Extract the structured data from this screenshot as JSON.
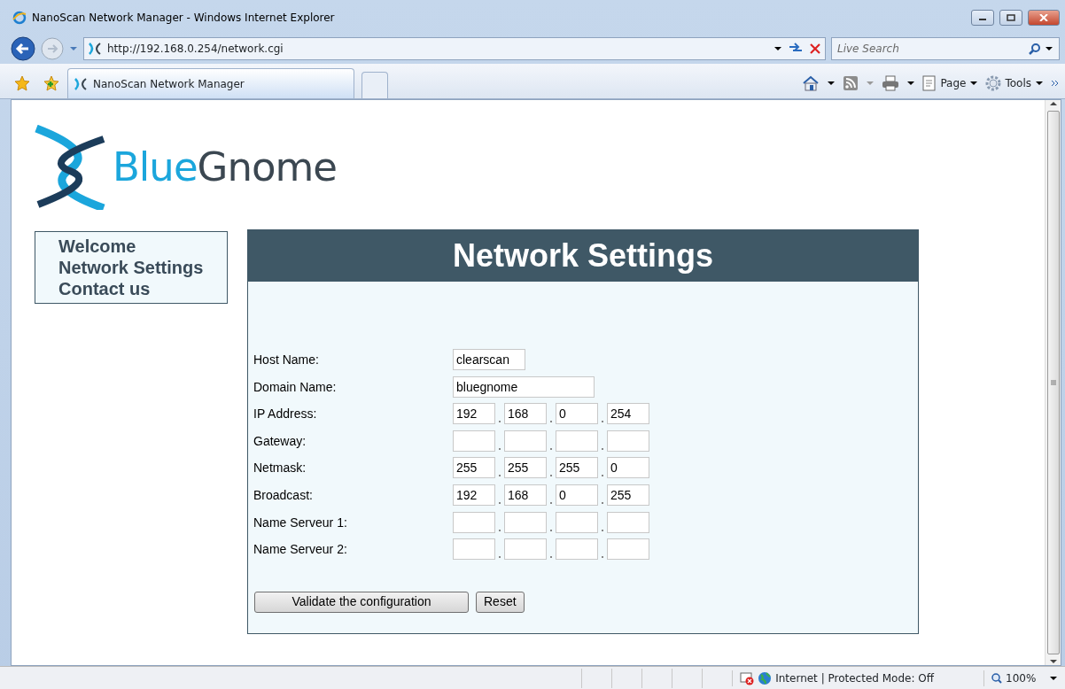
{
  "window": {
    "title": "NanoScan Network Manager - Windows Internet Explorer"
  },
  "address_bar": {
    "url": "http://192.168.0.254/network.cgi"
  },
  "search": {
    "placeholder": "Live Search"
  },
  "tabs": [
    {
      "label": "NanoScan Network Manager",
      "selected": true
    }
  ],
  "command_bar": [
    {
      "label": "Page"
    },
    {
      "label": "Tools"
    }
  ],
  "logo": {
    "part_1": "Blue",
    "part_2": "Gnome"
  },
  "nav": [
    {
      "label": "Welcome"
    },
    {
      "label": "Network Settings"
    },
    {
      "label": "Contact us"
    }
  ],
  "panel": {
    "title": "Network Settings"
  },
  "fields": [
    {
      "label": "Host Name:",
      "kind": "short_text",
      "value": "clearscan"
    },
    {
      "label": "Domain Name:",
      "kind": "long_text",
      "value": "bluegnome"
    },
    {
      "label": "IP Address:",
      "kind": "ip",
      "octets": [
        "192",
        "168",
        "0",
        "254"
      ]
    },
    {
      "label": "Gateway:",
      "kind": "ip"
    },
    {
      "label": "Netmask:",
      "kind": "ip",
      "octets": [
        "255",
        "255",
        "255",
        "0"
      ]
    },
    {
      "label": "Broadcast:",
      "kind": "ip",
      "octets": [
        "192",
        "168",
        "0",
        "255"
      ]
    },
    {
      "label": "Name Serveur 1:",
      "kind": "ip"
    },
    {
      "label": "Name Serveur 2:",
      "kind": "ip"
    }
  ],
  "buttons": [
    {
      "label": "Validate the configuration",
      "kind": "wide"
    },
    {
      "label": "Reset",
      "kind": "small"
    }
  ],
  "status_bar": {
    "zone": "Internet | Protected Mode: Off",
    "zoom": "100%"
  }
}
